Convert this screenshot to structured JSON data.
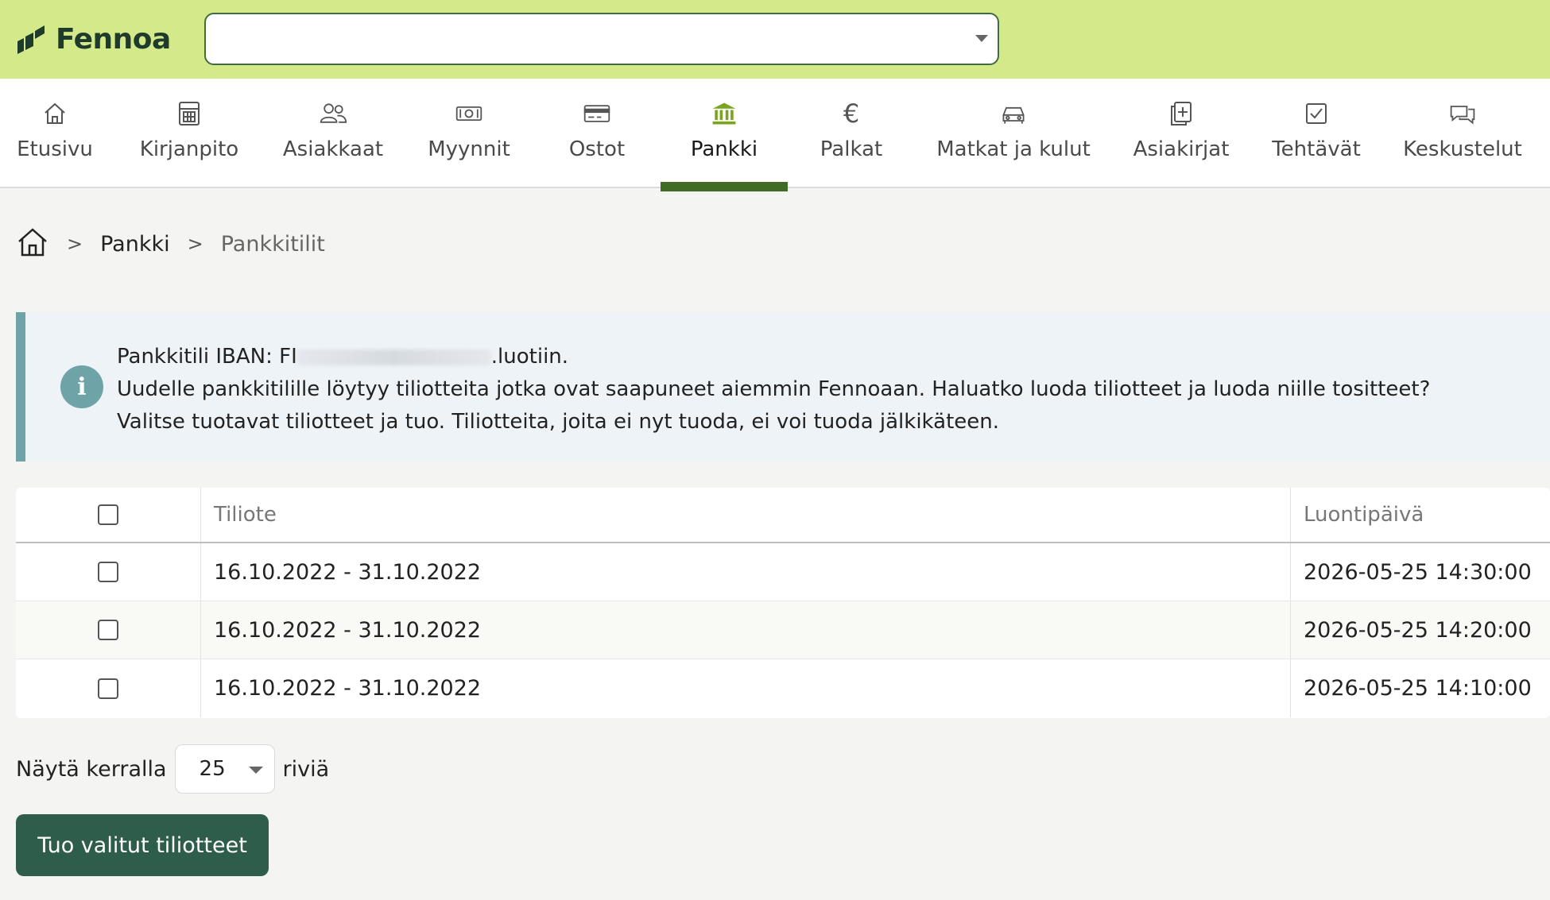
{
  "brand": {
    "name": "Fennoa"
  },
  "company_select": {
    "value": ""
  },
  "nav": [
    {
      "label": "Etusivu",
      "icon": "home-icon"
    },
    {
      "label": "Kirjanpito",
      "icon": "calculator-icon"
    },
    {
      "label": "Asiakkaat",
      "icon": "users-icon"
    },
    {
      "label": "Myynnit",
      "icon": "banknote-icon"
    },
    {
      "label": "Ostot",
      "icon": "credit-card-icon"
    },
    {
      "label": "Pankki",
      "icon": "bank-icon",
      "active": true
    },
    {
      "label": "Palkat",
      "icon": "euro-icon"
    },
    {
      "label": "Matkat ja kulut",
      "icon": "car-icon"
    },
    {
      "label": "Asiakirjat",
      "icon": "documents-add-icon"
    },
    {
      "label": "Tehtävät",
      "icon": "checkbox-icon"
    },
    {
      "label": "Keskustelut",
      "icon": "chat-icon"
    }
  ],
  "breadcrumb": {
    "sep": ">",
    "items": [
      "Pankki",
      "Pankkitilit"
    ]
  },
  "info": {
    "line1_prefix": "Pankkitili IBAN: FI",
    "line1_suffix": ".luotiin.",
    "line2": "Uudelle pankkitilille löytyy tiliotteita jotka ovat saapuneet aiemmin Fennoaan. Haluatko luoda tiliotteet ja luoda niille tositteet?",
    "line3": "Valitse tuotavat tiliotteet ja tuo. Tiliotteita, joita ei nyt tuoda, ei voi tuoda jälkikäteen."
  },
  "table": {
    "columns": [
      "Tiliote",
      "Luontipäivä"
    ],
    "rows": [
      {
        "tiliote": "16.10.2022 - 31.10.2022",
        "luontipaiva": "2026-05-25 14:30:00"
      },
      {
        "tiliote": "16.10.2022 - 31.10.2022",
        "luontipaiva": "2026-05-25 14:20:00"
      },
      {
        "tiliote": "16.10.2022 - 31.10.2022",
        "luontipaiva": "2026-05-25 14:10:00"
      }
    ]
  },
  "pagesize": {
    "prefix": "Näytä kerralla",
    "value": "25",
    "suffix": "riviä"
  },
  "import_button": {
    "label": "Tuo valitut tiliotteet"
  },
  "colors": {
    "topbar": "#d3e98a",
    "accent": "#3f6b25",
    "button": "#2f5d4c",
    "info_border": "#6ea3a8"
  }
}
